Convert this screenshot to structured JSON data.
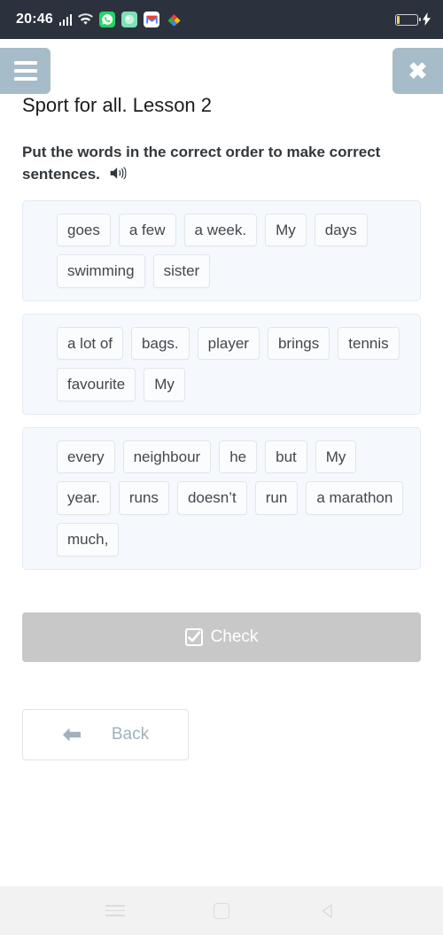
{
  "status_bar": {
    "time": "20:46",
    "icons": [
      "signal-bars-icon",
      "wifi-icon",
      "whatsapp-icon",
      "green-app-icon",
      "gmail-icon",
      "colorful-app-icon"
    ],
    "whatsapp_glyph": "✆",
    "green_glyph": "●",
    "gmail_glyph": "M",
    "battery": {
      "label": "battery-low",
      "charging": true,
      "bolt_glyph": "⚡"
    }
  },
  "top_bar": {
    "menu_label": "menu-button",
    "close_glyph": "✖",
    "button_color": "#a6bcc8"
  },
  "header": {
    "title": "Sport for all. Lesson 2"
  },
  "instruction": {
    "text": "Put the words in the correct order to make correct sentences.",
    "audio_icon": "speaker-icon"
  },
  "word_groups": [
    {
      "id": "sentence-1",
      "words": [
        "goes",
        "a few",
        "a week.",
        "My",
        "days",
        "swimming",
        "sister"
      ]
    },
    {
      "id": "sentence-2",
      "words": [
        "a lot of",
        "bags.",
        "player",
        "brings",
        "tennis",
        "favourite",
        "My"
      ]
    },
    {
      "id": "sentence-3",
      "words": [
        "every",
        "neighbour",
        "he",
        "but",
        "My",
        "year.",
        "runs",
        "doesn’t",
        "run",
        "a marathon",
        "much,"
      ]
    }
  ],
  "actions": {
    "check_label": "Check",
    "check_icon": "checkbox-checked-icon",
    "check_color": "#c8c8c8",
    "back_label": "Back",
    "back_icon": "arrow-left-icon",
    "back_color": "#9fb1bd"
  },
  "nav_bar": {
    "recents_label": "recents-button",
    "home_label": "home-button",
    "back_label": "back-button"
  }
}
